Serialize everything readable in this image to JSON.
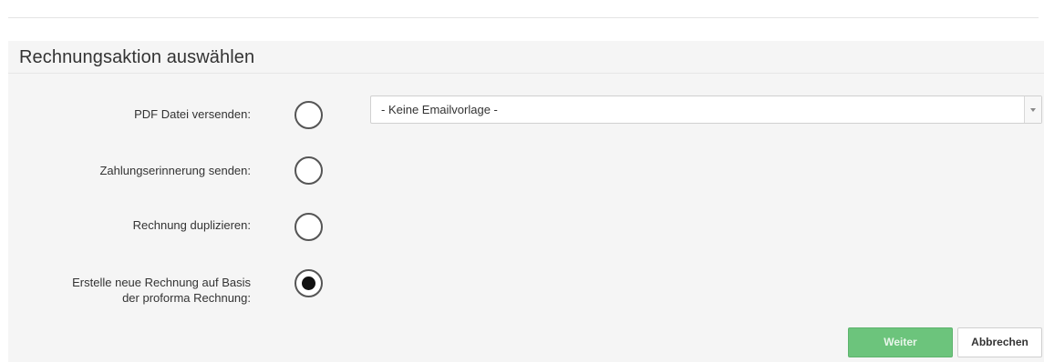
{
  "dialog": {
    "title": "Rechnungsaktion auswählen"
  },
  "options": [
    {
      "label": "PDF Datei versenden:",
      "selected": false
    },
    {
      "label": "Zahlungserinnerung senden:",
      "selected": false
    },
    {
      "label": "Rechnung duplizieren:",
      "selected": false
    },
    {
      "label_line1": "Erstelle neue Rechnung auf Basis",
      "label_line2": "der proforma Rechnung:",
      "selected": true
    }
  ],
  "email_template_select": {
    "value": "- Keine Emailvorlage -"
  },
  "buttons": {
    "next_label": "Weiter",
    "cancel_label": "Abbrechen"
  },
  "colors": {
    "primary_button": "#6cc47c",
    "panel_background": "#f5f5f5"
  }
}
